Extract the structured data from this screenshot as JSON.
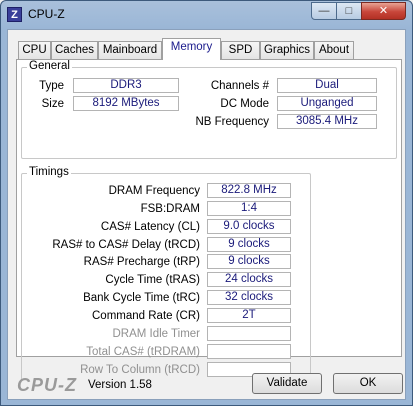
{
  "window": {
    "icon_letter": "Z",
    "title": "CPU-Z",
    "min_glyph": "—",
    "max_glyph": "□",
    "close_glyph": "✕"
  },
  "tabs": [
    {
      "label": "CPU"
    },
    {
      "label": "Caches"
    },
    {
      "label": "Mainboard"
    },
    {
      "label": "Memory",
      "active": true
    },
    {
      "label": "SPD"
    },
    {
      "label": "Graphics"
    },
    {
      "label": "About"
    }
  ],
  "general": {
    "title": "General",
    "type_label": "Type",
    "type_value": "DDR3",
    "size_label": "Size",
    "size_value": "8192 MBytes",
    "channels_label": "Channels #",
    "channels_value": "Dual",
    "dc_mode_label": "DC Mode",
    "dc_mode_value": "Unganged",
    "nb_freq_label": "NB Frequency",
    "nb_freq_value": "3085.4 MHz"
  },
  "timings": {
    "title": "Timings",
    "rows": [
      {
        "label": "DRAM Frequency",
        "value": "822.8 MHz"
      },
      {
        "label": "FSB:DRAM",
        "value": "1:4"
      },
      {
        "label": "CAS# Latency (CL)",
        "value": "9.0 clocks"
      },
      {
        "label": "RAS# to CAS# Delay (tRCD)",
        "value": "9 clocks"
      },
      {
        "label": "RAS# Precharge (tRP)",
        "value": "9 clocks"
      },
      {
        "label": "Cycle Time (tRAS)",
        "value": "24 clocks"
      },
      {
        "label": "Bank Cycle Time (tRC)",
        "value": "32 clocks"
      },
      {
        "label": "Command Rate (CR)",
        "value": "2T"
      },
      {
        "label": "DRAM Idle Timer",
        "value": "",
        "disabled": true
      },
      {
        "label": "Total CAS# (tRDRAM)",
        "value": "",
        "disabled": true
      },
      {
        "label": "Row To Column (tRCD)",
        "value": "",
        "disabled": true
      }
    ]
  },
  "footer": {
    "brand": "CPU-Z",
    "version": "Version 1.58",
    "validate_label": "Validate",
    "ok_label": "OK"
  }
}
